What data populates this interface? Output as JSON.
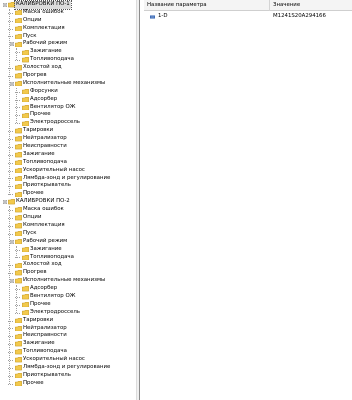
{
  "tree": [
    {
      "depth": 0,
      "label": "КАЛИБРОВКИ ПО-1",
      "expanded": true,
      "toggle": "minus",
      "selected": true
    },
    {
      "depth": 1,
      "label": "Маска ошибок"
    },
    {
      "depth": 1,
      "label": "Опции"
    },
    {
      "depth": 1,
      "label": "Комплектация"
    },
    {
      "depth": 1,
      "label": "Пуск"
    },
    {
      "depth": 1,
      "label": "Рабочий режим",
      "toggle": "minus"
    },
    {
      "depth": 2,
      "label": "Зажигание"
    },
    {
      "depth": 2,
      "label": "Топливоподача"
    },
    {
      "depth": 1,
      "label": "Холостой ход"
    },
    {
      "depth": 1,
      "label": "Прогрев"
    },
    {
      "depth": 1,
      "label": "Исполнительные механизмы",
      "toggle": "minus"
    },
    {
      "depth": 2,
      "label": "Форсунки"
    },
    {
      "depth": 2,
      "label": "Адсорбер"
    },
    {
      "depth": 2,
      "label": "Вентилятор ОЖ"
    },
    {
      "depth": 2,
      "label": "Прочее"
    },
    {
      "depth": 2,
      "label": "Электродроссель"
    },
    {
      "depth": 1,
      "label": "Тарировки"
    },
    {
      "depth": 1,
      "label": "Нейтрализатор"
    },
    {
      "depth": 1,
      "label": "Неисправности"
    },
    {
      "depth": 1,
      "label": "Зажигание"
    },
    {
      "depth": 1,
      "label": "Топливоподача"
    },
    {
      "depth": 1,
      "label": "Ускорительный насос"
    },
    {
      "depth": 1,
      "label": "Лямбда-зонд и регулирование"
    },
    {
      "depth": 1,
      "label": "Приоткрыватель"
    },
    {
      "depth": 1,
      "label": "Прочее"
    },
    {
      "depth": 0,
      "label": "КАЛИБРОВКИ ПО-2",
      "toggle": "minus"
    },
    {
      "depth": 1,
      "label": "Маска ошибок"
    },
    {
      "depth": 1,
      "label": "Опции"
    },
    {
      "depth": 1,
      "label": "Комплектация"
    },
    {
      "depth": 1,
      "label": "Пуск"
    },
    {
      "depth": 1,
      "label": "Рабочий режим",
      "toggle": "minus"
    },
    {
      "depth": 2,
      "label": "Зажигание"
    },
    {
      "depth": 2,
      "label": "Топливоподача"
    },
    {
      "depth": 1,
      "label": "Холостой ход"
    },
    {
      "depth": 1,
      "label": "Прогрев"
    },
    {
      "depth": 1,
      "label": "Исполнительные механизмы",
      "toggle": "minus"
    },
    {
      "depth": 2,
      "label": "Адсорбер"
    },
    {
      "depth": 2,
      "label": "Вентилятор ОЖ"
    },
    {
      "depth": 2,
      "label": "Прочее"
    },
    {
      "depth": 2,
      "label": "Электродроссель"
    },
    {
      "depth": 1,
      "label": "Тарировки"
    },
    {
      "depth": 1,
      "label": "Нейтрализатор"
    },
    {
      "depth": 1,
      "label": "Неисправности"
    },
    {
      "depth": 1,
      "label": "Зажигание"
    },
    {
      "depth": 1,
      "label": "Топливоподача"
    },
    {
      "depth": 1,
      "label": "Ускорительный насос"
    },
    {
      "depth": 1,
      "label": "Лямбда-зонд и регулирование"
    },
    {
      "depth": 1,
      "label": "Приоткрыватель"
    },
    {
      "depth": 1,
      "label": "Прочее"
    }
  ],
  "grid": {
    "columns": {
      "name": "Название параметра",
      "value": "Значение"
    },
    "rows": [
      {
        "name": "1-D",
        "value": "M1241S20A294166"
      }
    ]
  },
  "colors": {
    "folder_fill": "#f2c94c",
    "folder_edge": "#b8860b",
    "selection": "#dcdcdc",
    "param_icon": "#2a5db0"
  }
}
